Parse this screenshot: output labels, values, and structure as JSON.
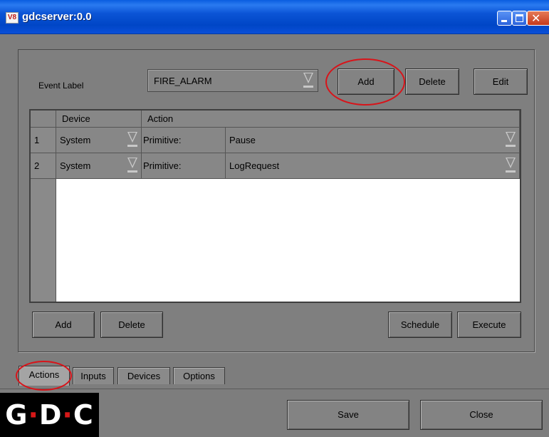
{
  "window": {
    "title": "gdcserver:0.0",
    "icon_text": "V8",
    "close_glyph": "✕"
  },
  "event": {
    "label": "Event Label",
    "selected": "FIRE_ALARM",
    "add_label": "Add",
    "delete_label": "Delete",
    "edit_label": "Edit"
  },
  "table": {
    "columns": [
      "Device",
      "Action"
    ],
    "rows": [
      {
        "num": "1",
        "device": "System",
        "type": "Primitive:",
        "action": "Pause"
      },
      {
        "num": "2",
        "device": "System",
        "type": "Primitive:",
        "action": "LogRequest"
      }
    ]
  },
  "actions_bar": {
    "add_label": "Add",
    "delete_label": "Delete",
    "schedule_label": "Schedule",
    "execute_label": "Execute"
  },
  "tabs": [
    "Actions",
    "Inputs",
    "Devices",
    "Options"
  ],
  "active_tab": "Actions",
  "footer": {
    "save_label": "Save",
    "close_label": "Close",
    "logo": {
      "g": "G",
      "d": "D",
      "c": "C",
      "sep": "·"
    }
  },
  "colors": {
    "title_blue": "#0046c6",
    "highlight_red": "#d8141a",
    "panel_gray": "#7f7f7f"
  }
}
